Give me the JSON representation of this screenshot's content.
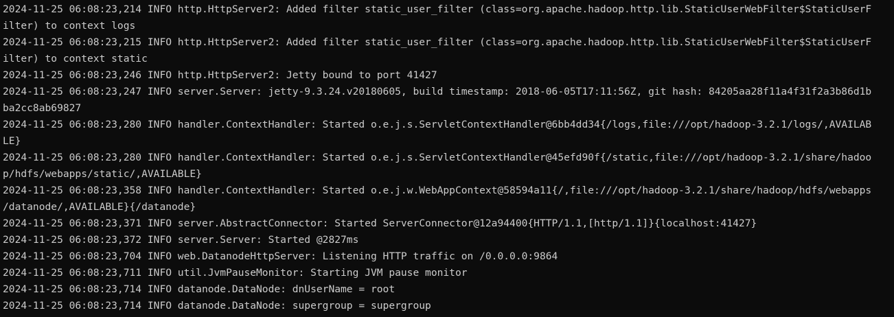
{
  "terminal": {
    "colors": {
      "background": "#0c0c0c",
      "foreground": "#cccccc"
    },
    "lines": [
      "2024-11-25 06:08:23,214 INFO http.HttpServer2: Added filter static_user_filter (class=org.apache.hadoop.http.lib.StaticUserWebFilter$StaticUserF",
      "ilter) to context logs",
      "2024-11-25 06:08:23,215 INFO http.HttpServer2: Added filter static_user_filter (class=org.apache.hadoop.http.lib.StaticUserWebFilter$StaticUserF",
      "ilter) to context static",
      "2024-11-25 06:08:23,246 INFO http.HttpServer2: Jetty bound to port 41427",
      "2024-11-25 06:08:23,247 INFO server.Server: jetty-9.3.24.v20180605, build timestamp: 2018-06-05T17:11:56Z, git hash: 84205aa28f11a4f31f2a3b86d1b",
      "ba2cc8ab69827",
      "2024-11-25 06:08:23,280 INFO handler.ContextHandler: Started o.e.j.s.ServletContextHandler@6bb4dd34{/logs,file:///opt/hadoop-3.2.1/logs/,AVAILAB",
      "LE}",
      "2024-11-25 06:08:23,280 INFO handler.ContextHandler: Started o.e.j.s.ServletContextHandler@45efd90f{/static,file:///opt/hadoop-3.2.1/share/hadoo",
      "p/hdfs/webapps/static/,AVAILABLE}",
      "2024-11-25 06:08:23,358 INFO handler.ContextHandler: Started o.e.j.w.WebAppContext@58594a11{/,file:///opt/hadoop-3.2.1/share/hadoop/hdfs/webapps",
      "/datanode/,AVAILABLE}{/datanode}",
      "2024-11-25 06:08:23,371 INFO server.AbstractConnector: Started ServerConnector@12a94400{HTTP/1.1,[http/1.1]}{localhost:41427}",
      "2024-11-25 06:08:23,372 INFO server.Server: Started @2827ms",
      "2024-11-25 06:08:23,704 INFO web.DatanodeHttpServer: Listening HTTP traffic on /0.0.0.0:9864",
      "2024-11-25 06:08:23,711 INFO util.JvmPauseMonitor: Starting JVM pause monitor",
      "2024-11-25 06:08:23,714 INFO datanode.DataNode: dnUserName = root",
      "2024-11-25 06:08:23,714 INFO datanode.DataNode: supergroup = supergroup"
    ]
  }
}
